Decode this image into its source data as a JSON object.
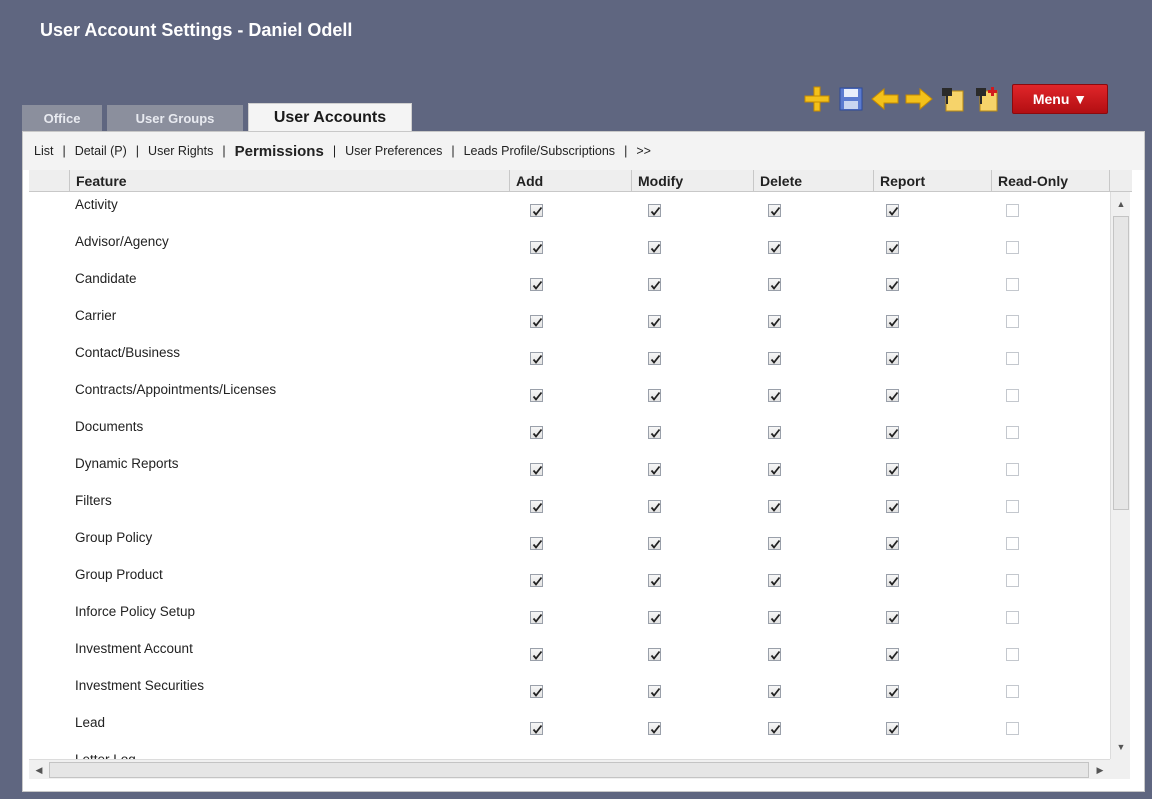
{
  "window": {
    "title": "User Account Settings - Daniel Odell"
  },
  "toolbar": {
    "icons": [
      "add-icon",
      "save-icon",
      "back-arrow-icon",
      "forward-arrow-icon",
      "pin-document-icon",
      "pin-new-document-icon"
    ],
    "menu_label": "Menu ▼"
  },
  "tabs": [
    {
      "label": "Office",
      "active": false
    },
    {
      "label": "User Groups",
      "active": false
    },
    {
      "label": "User Accounts",
      "active": true
    }
  ],
  "subnav": {
    "items": [
      "List",
      "Detail (P)",
      "User Rights",
      "Permissions",
      "User Preferences",
      "Leads Profile/Subscriptions",
      ">>"
    ],
    "current": "Permissions",
    "separator": "|"
  },
  "table": {
    "columns": [
      "Feature",
      "Add",
      "Modify",
      "Delete",
      "Report",
      "Read-Only"
    ],
    "rows": [
      {
        "feature": "Activity",
        "add": true,
        "modify": true,
        "delete": true,
        "report": true,
        "read_only": false
      },
      {
        "feature": "Advisor/Agency",
        "add": true,
        "modify": true,
        "delete": true,
        "report": true,
        "read_only": false
      },
      {
        "feature": "Candidate",
        "add": true,
        "modify": true,
        "delete": true,
        "report": true,
        "read_only": false
      },
      {
        "feature": "Carrier",
        "add": true,
        "modify": true,
        "delete": true,
        "report": true,
        "read_only": false
      },
      {
        "feature": "Contact/Business",
        "add": true,
        "modify": true,
        "delete": true,
        "report": true,
        "read_only": false
      },
      {
        "feature": "Contracts/Appointments/Licenses",
        "add": true,
        "modify": true,
        "delete": true,
        "report": true,
        "read_only": false
      },
      {
        "feature": "Documents",
        "add": true,
        "modify": true,
        "delete": true,
        "report": true,
        "read_only": false
      },
      {
        "feature": "Dynamic Reports",
        "add": true,
        "modify": true,
        "delete": true,
        "report": true,
        "read_only": false
      },
      {
        "feature": "Filters",
        "add": true,
        "modify": true,
        "delete": true,
        "report": true,
        "read_only": false
      },
      {
        "feature": "Group Policy",
        "add": true,
        "modify": true,
        "delete": true,
        "report": true,
        "read_only": false
      },
      {
        "feature": "Group Product",
        "add": true,
        "modify": true,
        "delete": true,
        "report": true,
        "read_only": false
      },
      {
        "feature": "Inforce Policy Setup",
        "add": true,
        "modify": true,
        "delete": true,
        "report": true,
        "read_only": false
      },
      {
        "feature": "Investment Account",
        "add": true,
        "modify": true,
        "delete": true,
        "report": true,
        "read_only": false
      },
      {
        "feature": "Investment Securities",
        "add": true,
        "modify": true,
        "delete": true,
        "report": true,
        "read_only": false
      },
      {
        "feature": "Lead",
        "add": true,
        "modify": true,
        "delete": true,
        "report": true,
        "read_only": false
      },
      {
        "feature": "Letter Log",
        "add": true,
        "modify": true,
        "delete": true,
        "report": true,
        "read_only": false
      }
    ]
  },
  "colors": {
    "background": "#5f6680",
    "menu_red": "#d21a1e",
    "tab_inactive": "#8b8f9d",
    "icon_yellow": "#f3c11a"
  }
}
